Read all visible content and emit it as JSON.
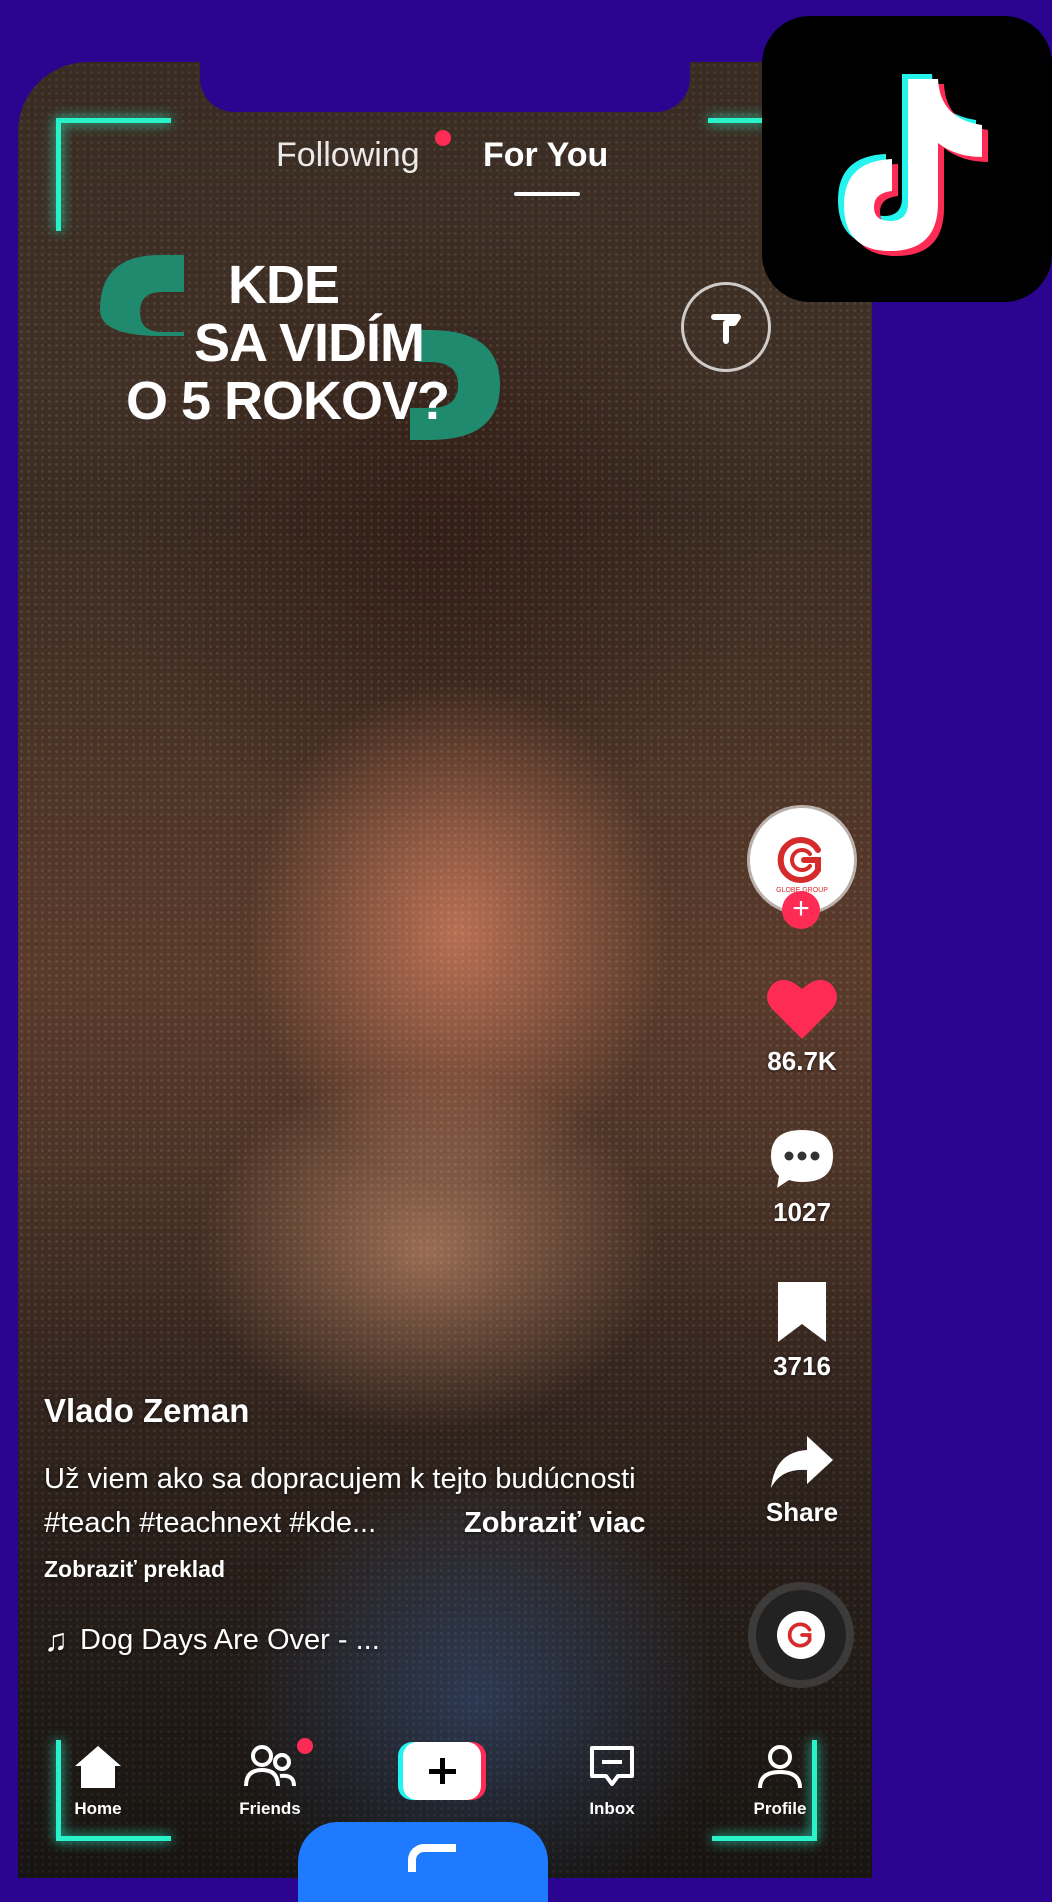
{
  "top_tabs": {
    "following": "Following",
    "for_you": "For You"
  },
  "headline": {
    "line1": "KDE",
    "line2": "SA VIDÍM",
    "line3": "O 5 ROKOV?"
  },
  "rail": {
    "likes": "86.7K",
    "comments": "1027",
    "saves": "3716",
    "share_label": "Share",
    "avatar_tag": "GLOBE GROUP"
  },
  "caption": {
    "username": "Vlado Zeman",
    "description_line1": "Už viem ako sa dopracujem k tejto budúcnosti",
    "description_line2": "#teach #teachnext #kde...",
    "see_more": "Zobraziť viac",
    "translate": "Zobraziť preklad",
    "music": "Dog Days Are Over - ..."
  },
  "bottom_nav": {
    "home": "Home",
    "friends": "Friends",
    "inbox": "Inbox",
    "profile": "Profile"
  },
  "colors": {
    "background": "#2b0490",
    "accent_pink": "#fe2c55",
    "accent_cyan": "#25f4ee",
    "bracket_glow": "#29f2c8",
    "headline_green": "#1f8a6d"
  },
  "icons": [
    "home-icon",
    "friends-icon",
    "create-plus-icon",
    "inbox-icon",
    "profile-icon",
    "heart-icon",
    "comment-icon",
    "bookmark-icon",
    "share-arrow-icon",
    "music-note-icon",
    "tiktok-logo-icon"
  ]
}
